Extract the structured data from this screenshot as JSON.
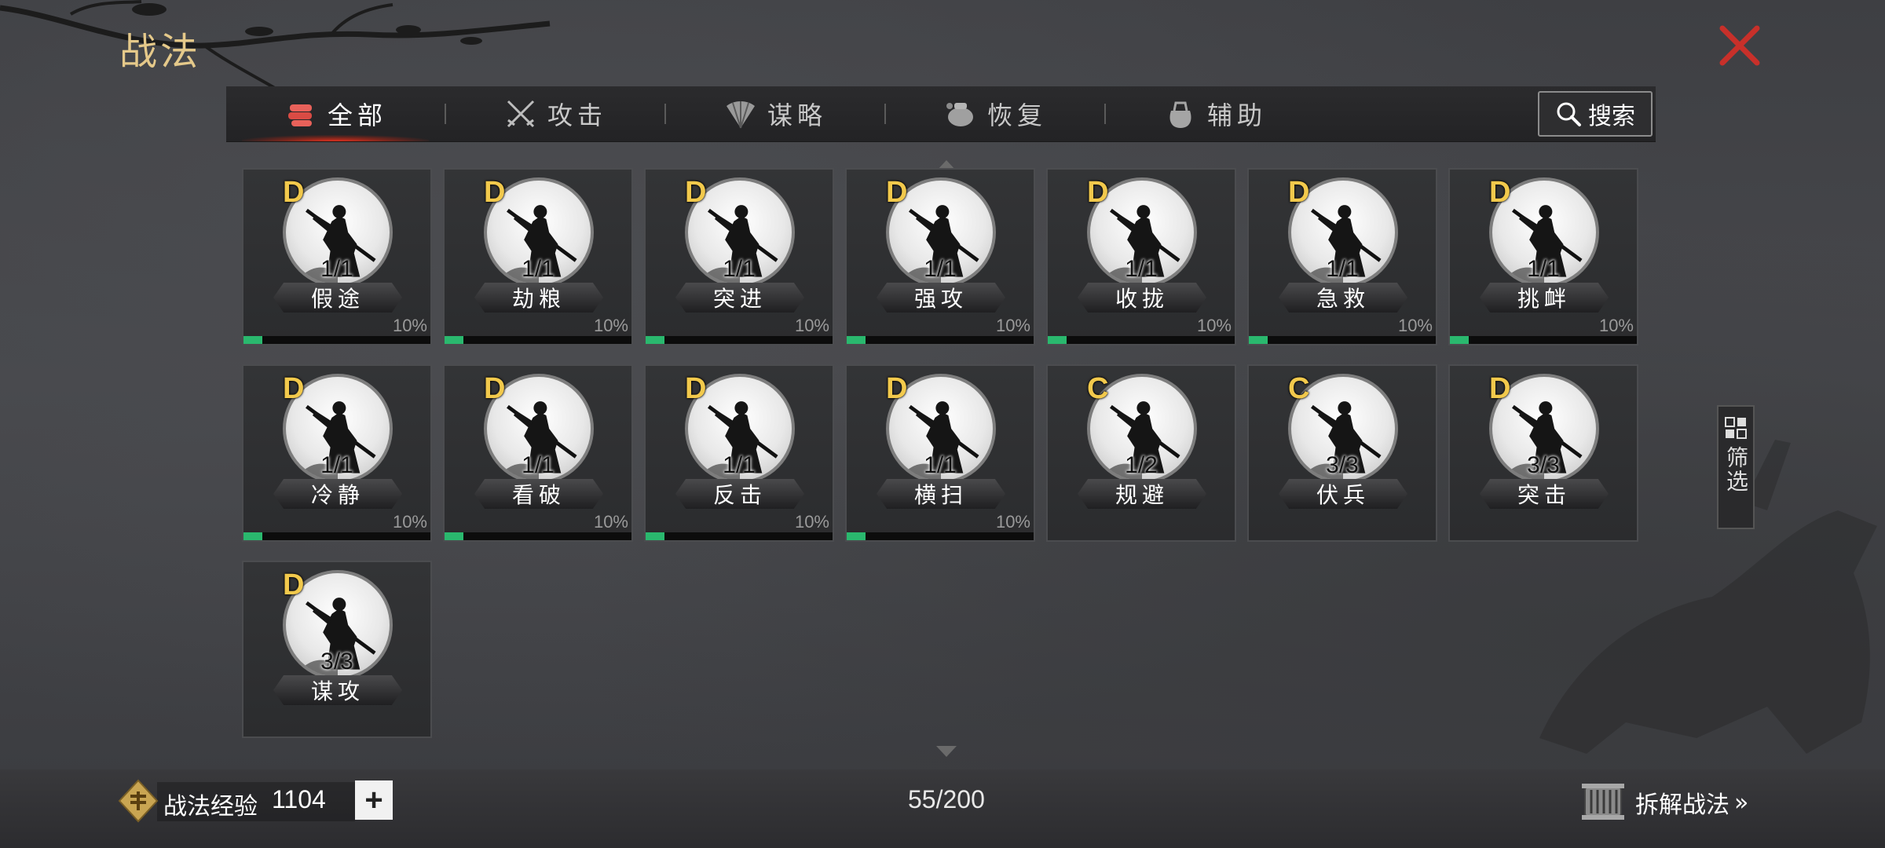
{
  "page": {
    "title": "战法"
  },
  "tabs": [
    {
      "label": "全部",
      "icon": "scroll-bundle-icon",
      "active": true
    },
    {
      "label": "攻击",
      "icon": "crossed-swords-icon",
      "active": false
    },
    {
      "label": "谋略",
      "icon": "fan-icon",
      "active": false
    },
    {
      "label": "恢复",
      "icon": "pot-icon",
      "active": false
    },
    {
      "label": "辅助",
      "icon": "bag-icon",
      "active": false
    }
  ],
  "search": {
    "label": "搜索",
    "icon": "search-icon"
  },
  "filter": {
    "label": "筛选",
    "icon": "grid-icon"
  },
  "cards": [
    {
      "grade": "D",
      "count": "1/1",
      "name": "假途",
      "progress_label": "10%",
      "progress": 0.1
    },
    {
      "grade": "D",
      "count": "1/1",
      "name": "劫粮",
      "progress_label": "10%",
      "progress": 0.1
    },
    {
      "grade": "D",
      "count": "1/1",
      "name": "突进",
      "progress_label": "10%",
      "progress": 0.1
    },
    {
      "grade": "D",
      "count": "1/1",
      "name": "强攻",
      "progress_label": "10%",
      "progress": 0.1
    },
    {
      "grade": "D",
      "count": "1/1",
      "name": "收拢",
      "progress_label": "10%",
      "progress": 0.1
    },
    {
      "grade": "D",
      "count": "1/1",
      "name": "急救",
      "progress_label": "10%",
      "progress": 0.1
    },
    {
      "grade": "D",
      "count": "1/1",
      "name": "挑衅",
      "progress_label": "10%",
      "progress": 0.1
    },
    {
      "grade": "D",
      "count": "1/1",
      "name": "冷静",
      "progress_label": "10%",
      "progress": 0.1
    },
    {
      "grade": "D",
      "count": "1/1",
      "name": "看破",
      "progress_label": "10%",
      "progress": 0.1
    },
    {
      "grade": "D",
      "count": "1/1",
      "name": "反击",
      "progress_label": "10%",
      "progress": 0.1
    },
    {
      "grade": "D",
      "count": "1/1",
      "name": "横扫",
      "progress_label": "10%",
      "progress": 0.1
    },
    {
      "grade": "C",
      "count": "1/2",
      "name": "规避"
    },
    {
      "grade": "C",
      "count": "3/3",
      "name": "伏兵"
    },
    {
      "grade": "D",
      "count": "3/3",
      "name": "突击"
    },
    {
      "grade": "D",
      "count": "3/3",
      "name": "谋攻"
    }
  ],
  "footer": {
    "exp_label": "战法经验",
    "exp_value": "1104",
    "plus": "+",
    "capacity": "55/200",
    "dismantle_label": "拆解战法",
    "dismantle_arrow": "»"
  },
  "colors": {
    "accent_gold": "#e5c98a",
    "grade_yellow": "#f2c94c",
    "progress_green": "#2ab86e",
    "close_red": "#c8302a",
    "active_tab_glow": "#e0301e"
  }
}
